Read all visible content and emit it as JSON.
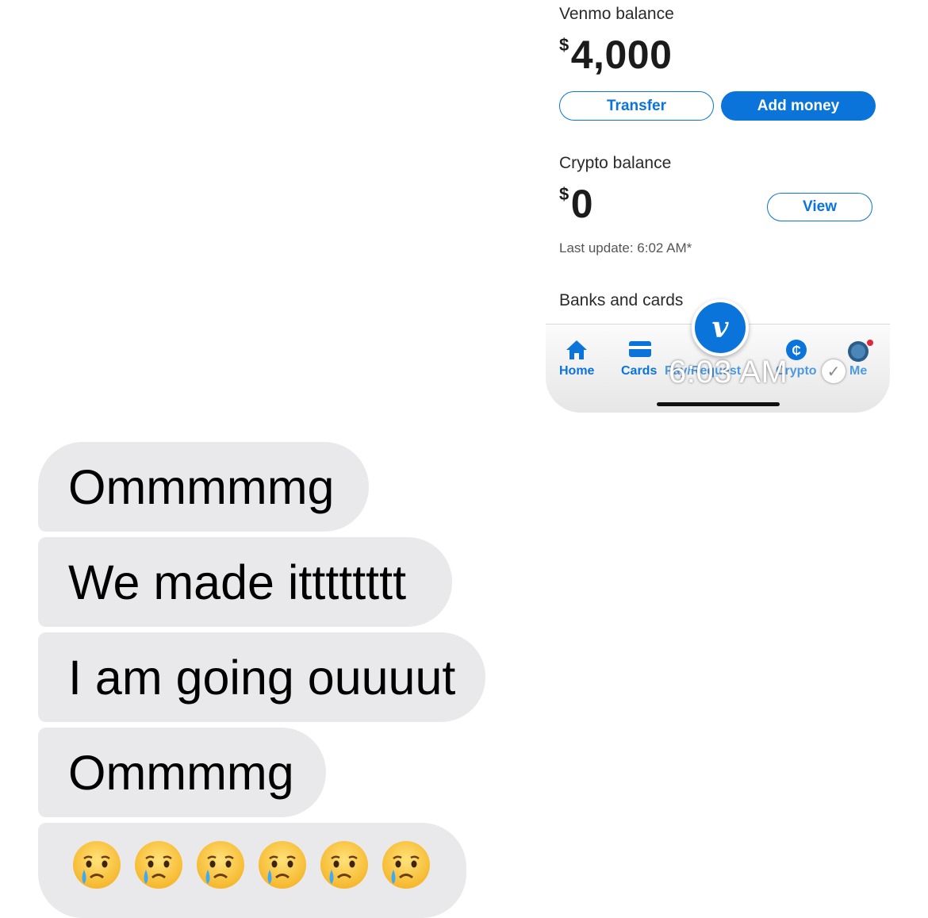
{
  "screenshot": {
    "venmo_balance_label": "Venmo balance",
    "venmo_currency": "$",
    "venmo_amount": "4,000",
    "transfer_label": "Transfer",
    "add_money_label": "Add money",
    "crypto_balance_label": "Crypto balance",
    "crypto_currency": "$",
    "crypto_amount": "0",
    "view_label": "View",
    "last_update": "Last update: 6:02 AM*",
    "banks_cards_label": "Banks and cards",
    "tabs": {
      "home": "Home",
      "cards": "Cards",
      "pay_request": "Pay/Request",
      "crypto": "Crypto",
      "me": "Me"
    },
    "center_logo": "v",
    "sent_time": "6:03 AM",
    "accent_color": "#0a74da"
  },
  "messages": [
    {
      "text": "Ommmmmg"
    },
    {
      "text": "We made itttttttt"
    },
    {
      "text": "I am going ouuuut"
    },
    {
      "text": "Ommmmg"
    },
    {
      "emoji_name": "crying-face",
      "count": 6
    }
  ]
}
